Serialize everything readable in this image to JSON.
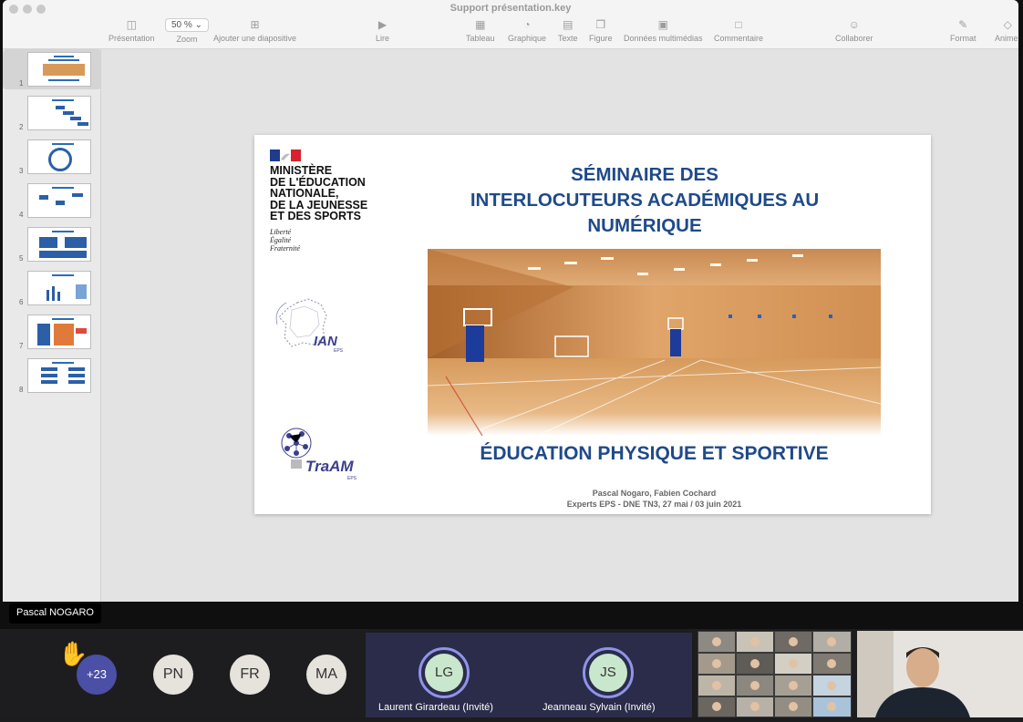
{
  "window": {
    "title": "Support présentation.key"
  },
  "toolbar": {
    "presentation": "Présentation",
    "zoom_value": "50 %",
    "zoom_label": "Zoom",
    "add_slide": "Ajouter une diapositive",
    "play": "Lire",
    "table": "Tableau",
    "chart": "Graphique",
    "text": "Texte",
    "shape": "Figure",
    "media": "Données multimédias",
    "comment": "Commentaire",
    "collaborate": "Collaborer",
    "format": "Format",
    "animate": "Animer"
  },
  "navigator": {
    "slides": [
      {
        "num": "1"
      },
      {
        "num": "2"
      },
      {
        "num": "3"
      },
      {
        "num": "4"
      },
      {
        "num": "5"
      },
      {
        "num": "6"
      },
      {
        "num": "7"
      },
      {
        "num": "8"
      }
    ]
  },
  "slide": {
    "ministry_lines": [
      "MINISTÈRE",
      "DE L'ÉDUCATION",
      "NATIONALE,",
      "DE LA JEUNESSE",
      "ET DES SPORTS"
    ],
    "devise_lines": [
      "Liberté",
      "Égalité",
      "Fraternité"
    ],
    "ian_logo_text": "IAN",
    "ian_logo_sub": "EPS",
    "traam_logo_text": "TraAM",
    "traam_logo_sub": "EPS",
    "title_lines": [
      "SÉMINAIRE DES",
      "INTERLOCUTEURS ACADÉMIQUES AU",
      "NUMÉRIQUE"
    ],
    "subtitle": "ÉDUCATION PHYSIQUE ET SPORTIVE",
    "authors": "Pascal Nogaro, Fabien Cochard",
    "event": "Experts EPS - DNE TN3, 27 mai / 03 juin 2021"
  },
  "presenter": {
    "name": "Pascal NOGARO"
  },
  "participants": {
    "overflow_count": "+23",
    "avatars": [
      {
        "initials": "PN"
      },
      {
        "initials": "FR"
      },
      {
        "initials": "MA"
      }
    ],
    "guests": [
      {
        "initials": "LG",
        "name": "Laurent Girardeau (Invité)"
      },
      {
        "initials": "JS",
        "name": "Jeanneau Sylvain (Invité)"
      }
    ]
  },
  "colors": {
    "slide_title": "#1f4a8a",
    "guest_ring": "#8f93e8",
    "count_badge": "#4b4fa6"
  }
}
